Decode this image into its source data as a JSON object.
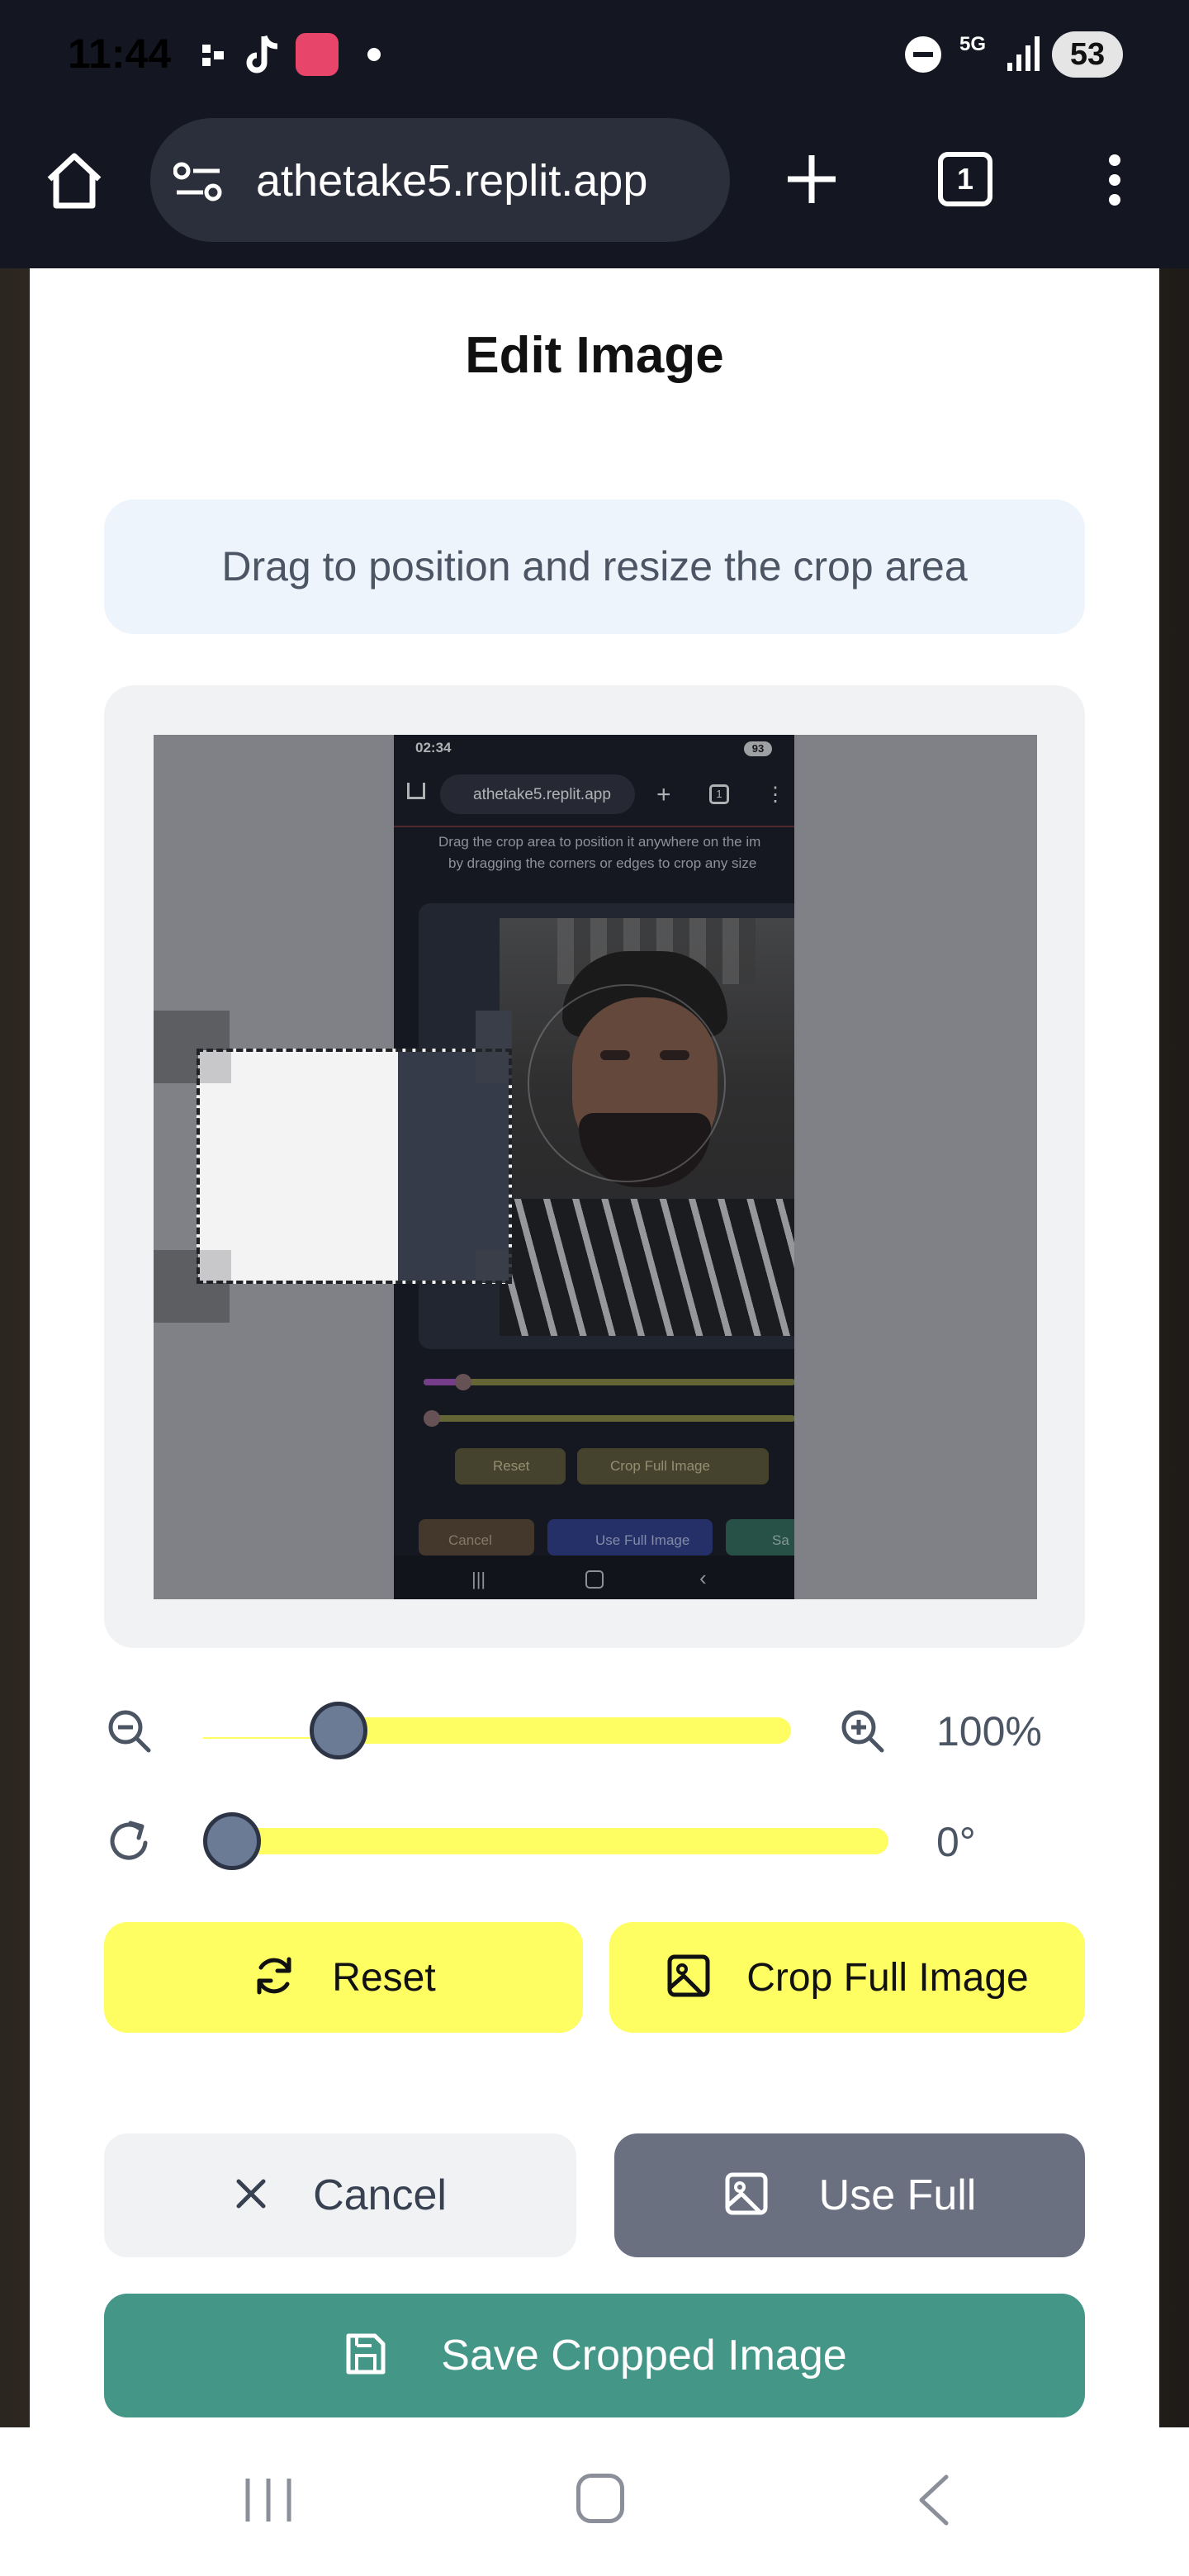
{
  "status_bar": {
    "time": "11:44",
    "network": "5G",
    "battery": "53"
  },
  "browser": {
    "url": "athetake5.replit.app",
    "tab_count": "1"
  },
  "modal": {
    "title": "Edit Image",
    "hint": "Drag to position and resize the crop area",
    "zoom": {
      "value_label": "100%",
      "level": 0.25
    },
    "rotation": {
      "value_label": "0°",
      "level": 0.0
    },
    "buttons": {
      "reset": "Reset",
      "crop_full": "Crop Full Image",
      "cancel": "Cancel",
      "use_full": "Use Full",
      "save": "Save Cropped Image"
    }
  },
  "preview_screenshot": {
    "time": "02:34",
    "battery": "93",
    "url": "athetake5.replit.app",
    "tab_count": "1",
    "hint_line1": "Drag the crop area to position it anywhere on the im",
    "hint_line2": "by dragging the corners or edges to crop any size",
    "reset": "Reset",
    "crop_full": "Crop Full Image",
    "cancel": "Cancel",
    "use_full": "Use Full Image",
    "save": "Sa"
  },
  "colors": {
    "accent_yellow": "#fefe62",
    "save_green": "#449686",
    "use_full_gray": "#6b7081",
    "cancel_bg": "#f1f2f4"
  }
}
